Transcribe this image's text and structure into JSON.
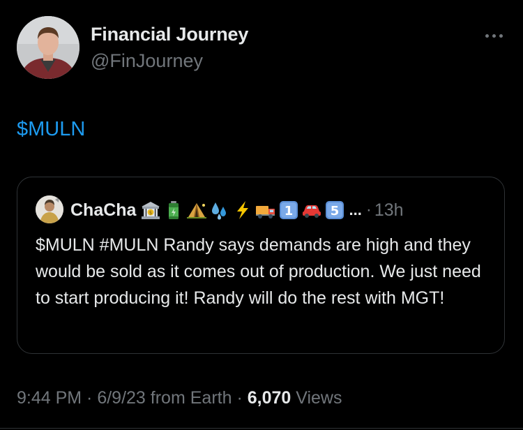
{
  "author": {
    "display_name": "Financial Journey",
    "handle": "@FinJourney",
    "avatar_icon": "profile-photo"
  },
  "tweet": {
    "text": "$MULN"
  },
  "quote": {
    "name": "ChaCha",
    "name_emojis": [
      "bank",
      "battery",
      "camping-tent",
      "sweat-droplets",
      "high-voltage",
      "delivery-truck",
      "keycap-1",
      "red-car",
      "keycap-5"
    ],
    "ellipsis": "...",
    "separator": "·",
    "time": "13h",
    "text": "$MULN #MULN Randy says demands are high and they would be sold as it comes out of production. We just need to start producing it! Randy will do the rest with MGT!"
  },
  "meta": {
    "time": "9:44 PM",
    "sep1": " · ",
    "date": "6/9/23",
    "source": " from Earth",
    "sep2": " · ",
    "views_count": "6,070",
    "views_label": " Views"
  },
  "colors": {
    "background": "#000000",
    "primary_text": "#e7e9ea",
    "secondary_text": "#71767b",
    "link": "#1d9bf0",
    "border": "#2f3336"
  }
}
